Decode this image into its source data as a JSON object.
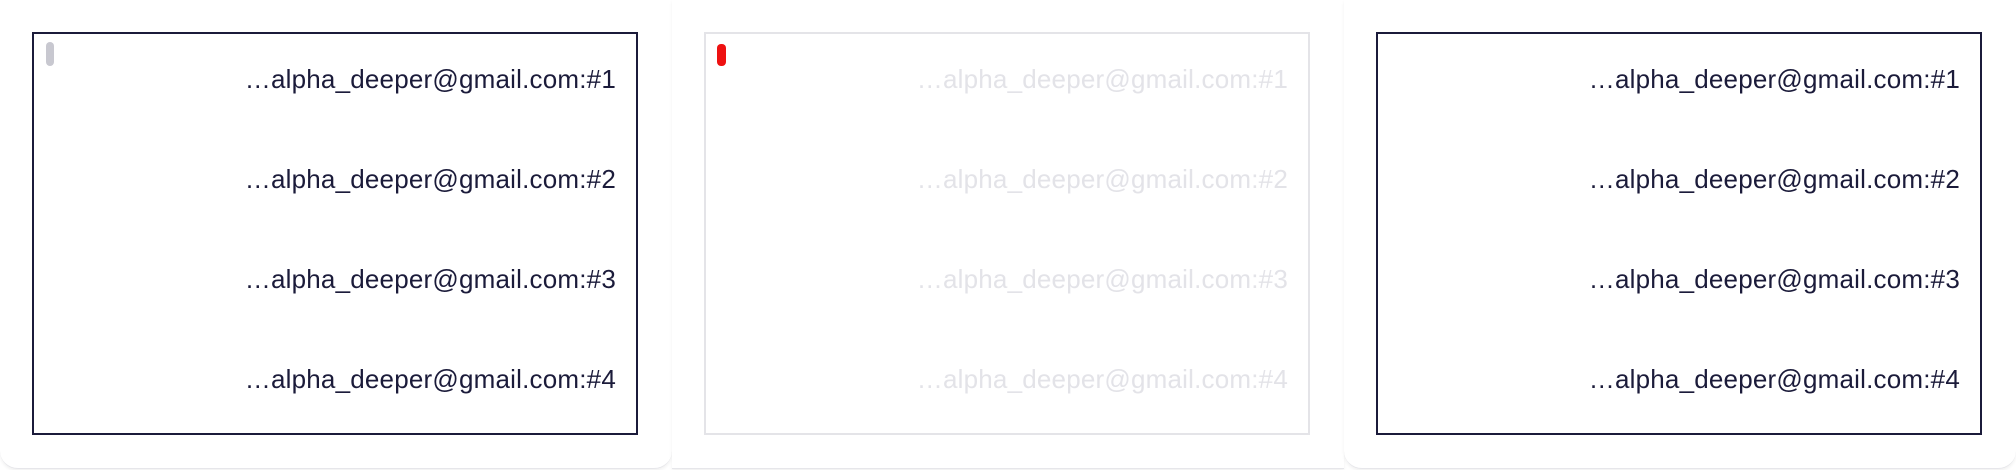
{
  "panels": [
    {
      "style": "dark",
      "items": [
        "…alpha_deeper@gmail.com:#1",
        "…alpha_deeper@gmail.com:#2",
        "…alpha_deeper@gmail.com:#3",
        "…alpha_deeper@gmail.com:#4"
      ],
      "scroll_thumb_color": "#c8c8d0"
    },
    {
      "style": "light",
      "items": [
        "…alpha_deeper@gmail.com:#1",
        "…alpha_deeper@gmail.com:#2",
        "…alpha_deeper@gmail.com:#3",
        "…alpha_deeper@gmail.com:#4"
      ],
      "scroll_thumb_color": "#ee1111"
    },
    {
      "style": "dark",
      "items": [
        "…alpha_deeper@gmail.com:#1",
        "…alpha_deeper@gmail.com:#2",
        "…alpha_deeper@gmail.com:#3",
        "…alpha_deeper@gmail.com:#4"
      ],
      "scroll_thumb_color": null
    }
  ],
  "colors": {
    "text_dark": "#1b1b3a",
    "text_disabled": "#e3e3e8",
    "border_dark": "#1b1b3a",
    "border_light": "#e4e4e8"
  }
}
